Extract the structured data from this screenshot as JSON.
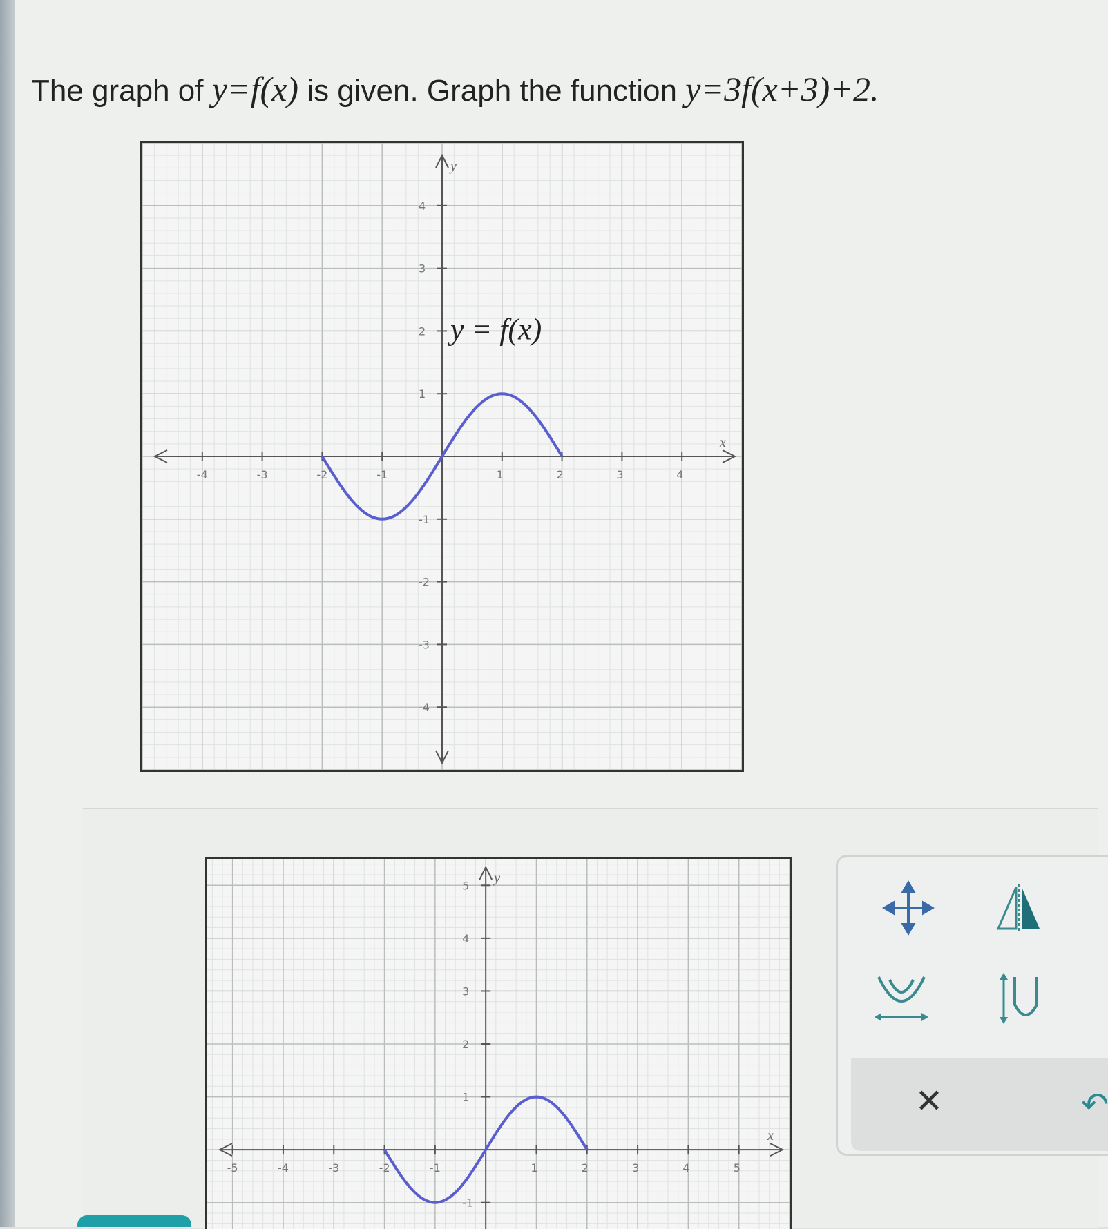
{
  "question": {
    "text_1": "The graph of",
    "math_1": "y=f(x)",
    "text_2": "is given. Graph the function",
    "math_2": "y=3f(x+3)+2."
  },
  "given_graph": {
    "curve_label": "y = f(x)",
    "axis_x": "x",
    "axis_y": "y",
    "x_ticks": [
      "-4",
      "-3",
      "-2",
      "-1",
      "1",
      "2",
      "3",
      "4"
    ],
    "y_ticks": [
      "4",
      "3",
      "2",
      "1",
      "-1",
      "-2",
      "-3",
      "-4"
    ],
    "curve_color": "#5a5fd0"
  },
  "answer_graph": {
    "axis_x": "x",
    "axis_y": "y",
    "x_ticks": [
      "-5",
      "-4",
      "-3",
      "-2",
      "-1",
      "1",
      "2",
      "3",
      "4",
      "5"
    ],
    "y_ticks": [
      "5",
      "4",
      "3",
      "2",
      "1",
      "-1"
    ],
    "curve_color": "#5a5fd0"
  },
  "chart_data": [
    {
      "type": "line",
      "name": "given",
      "xlim": [
        -5,
        5
      ],
      "ylim": [
        -5,
        5
      ],
      "x": [
        -2,
        -1.5,
        -1,
        -0.5,
        0,
        0.5,
        1,
        1.5,
        2
      ],
      "y": [
        0,
        -0.71,
        -1,
        -0.71,
        0,
        0.71,
        1,
        0.71,
        0
      ],
      "xlabel": "x",
      "ylabel": "y",
      "grid": true
    },
    {
      "type": "line",
      "name": "answer",
      "xlim": [
        -5.5,
        6
      ],
      "ylim": [
        -1.5,
        5.5
      ],
      "x": [
        -2,
        -1.5,
        -1,
        -0.5,
        0,
        0.5,
        1,
        1.5,
        2
      ],
      "y": [
        0,
        -0.71,
        -1,
        -0.71,
        0,
        0.71,
        1,
        0.71,
        0
      ],
      "xlabel": "x",
      "ylabel": "y",
      "grid": true
    }
  ],
  "toolbox": {
    "tools": [
      "move-icon",
      "reflect-icon",
      "horizontal-stretch-icon",
      "vertical-stretch-icon"
    ],
    "clear_symbol": "✕",
    "undo_symbol": "↶"
  }
}
